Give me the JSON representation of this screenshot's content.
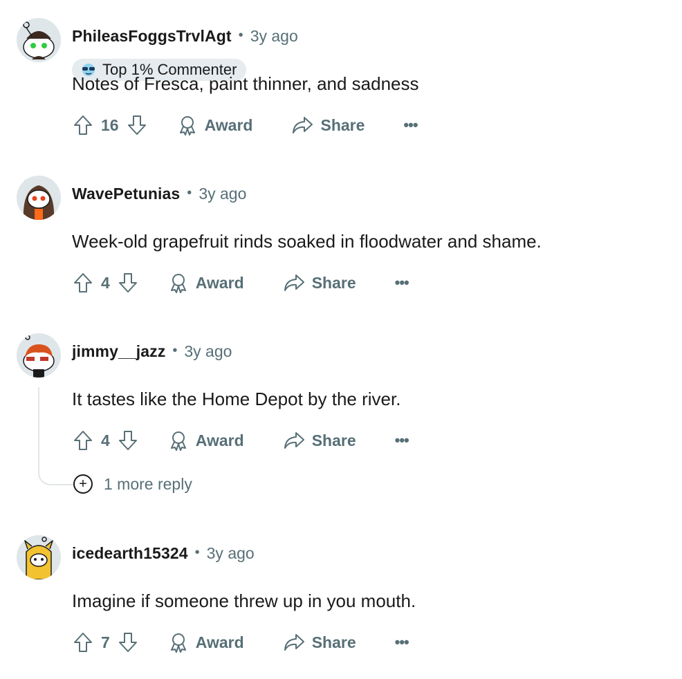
{
  "comments": [
    {
      "username": "PhileasFoggsTrvlAgt",
      "time": "3y ago",
      "flair": "Top 1% Commenter",
      "text": "Notes of Fresca, paint thinner, and sadness",
      "score": "16",
      "award_label": "Award",
      "share_label": "Share",
      "more_label": "•••"
    },
    {
      "username": "WavePetunias",
      "time": "3y ago",
      "text": "Week-old grapefruit rinds soaked in floodwater and shame.",
      "score": "4",
      "award_label": "Award",
      "share_label": "Share",
      "more_label": "•••"
    },
    {
      "username": "jimmy__jazz",
      "time": "3y ago",
      "text": "It tastes like the Home Depot by the river.",
      "score": "4",
      "award_label": "Award",
      "share_label": "Share",
      "more_label": "•••",
      "more_replies": "1 more reply"
    },
    {
      "username": "icedearth15324",
      "time": "3y ago",
      "text": "Imagine if someone threw up in you mouth.",
      "score": "7",
      "award_label": "Award",
      "share_label": "Share",
      "more_label": "•••"
    }
  ],
  "separator": "•",
  "plus_symbol": "+",
  "icons": {
    "upvote": "arrow-up-outline",
    "downvote": "arrow-down-outline",
    "award": "ribbon-award",
    "share": "share-arrow",
    "flair": "sunglasses-emoji"
  },
  "colors": {
    "text": "#1a1a1b",
    "meta": "#576f76",
    "flair_bg": "#e5ebee",
    "thread_line": "#e0e6e8"
  }
}
